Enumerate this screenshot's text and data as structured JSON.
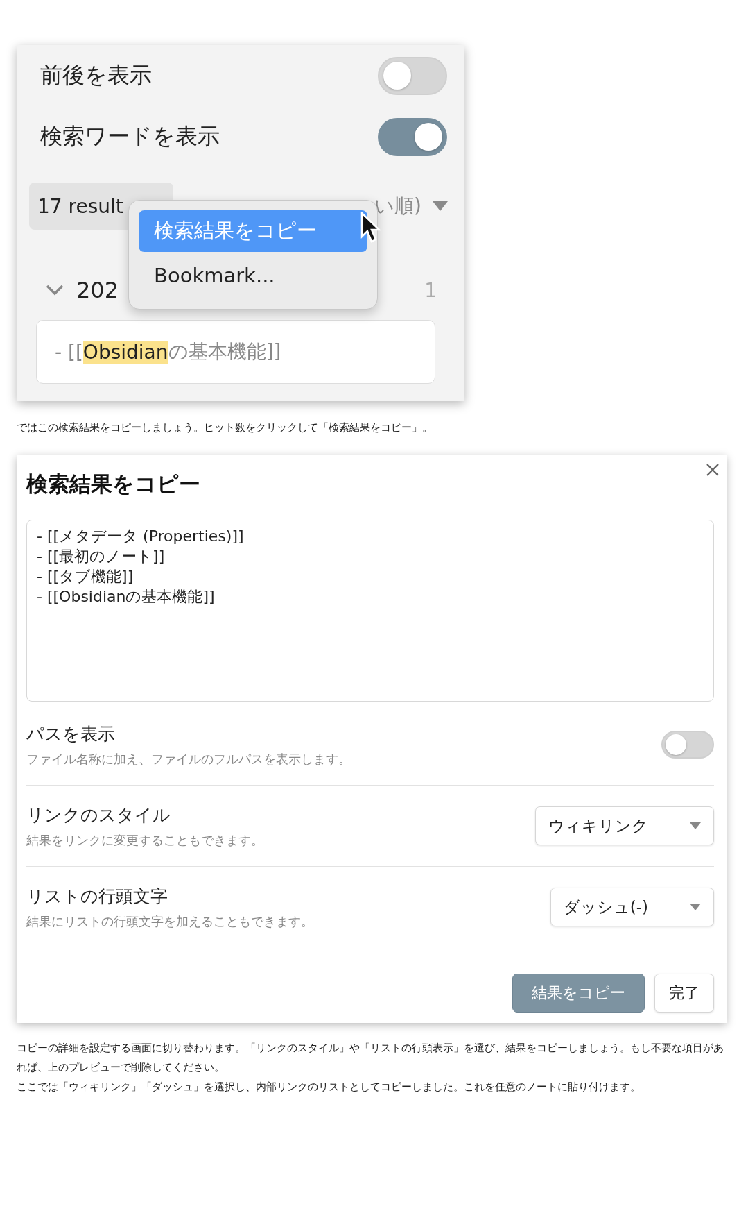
{
  "search_panel": {
    "options": [
      {
        "label": "前後を表示",
        "on": false
      },
      {
        "label": "検索ワードを表示",
        "on": true
      }
    ],
    "result_count": "17 result",
    "sort_label": "い順)",
    "group": {
      "label": "202",
      "count": "1",
      "expanded": true
    },
    "result": {
      "before": "- [[",
      "match": "Obsidian",
      "after": "の基本機能]]"
    },
    "context_menu": [
      {
        "label": "検索結果をコピー",
        "selected": true
      },
      {
        "label": "Bookmark...",
        "selected": false
      }
    ]
  },
  "caption": "ではこの検索結果をコピーしましょう。ヒット数をクリックして「検索結果をコピー」。",
  "copy_dialog": {
    "title": "検索結果をコピー",
    "preview_lines": [
      "- [[メタデータ (Properties)]]",
      "- [[最初のノート]]",
      "- [[タブ機能]]",
      "- [[Obsidianの基本機能]]"
    ],
    "settings": [
      {
        "kind": "toggle",
        "label": "パスを表示",
        "description": "ファイル名称に加え、ファイルのフルパスを表示します。",
        "on": false
      },
      {
        "kind": "dropdown",
        "label": "リンクのスタイル",
        "description": "結果をリンクに変更することもできます。",
        "value": "ウィキリンク"
      },
      {
        "kind": "dropdown",
        "label": "リストの行頭文字",
        "description": "結果にリストの行頭文字を加えることもできます。",
        "value": "ダッシュ(-)"
      }
    ],
    "buttons": [
      {
        "label": "結果をコピー",
        "primary": true
      },
      {
        "label": "完了",
        "primary": false
      }
    ]
  },
  "paragraphs": [
    "コピーの詳細を設定する画面に切り替わります。「リンクのスタイル」や「リストの行頭表示」を選び、結果をコピーしましょう。もし不要な項目があれば、上のプレビューで削除してください。",
    "ここでは「ウィキリンク」「ダッシュ」を選択し、内部リンクのリストとしてコピーしました。これを任意のノートに貼り付けます。"
  ]
}
